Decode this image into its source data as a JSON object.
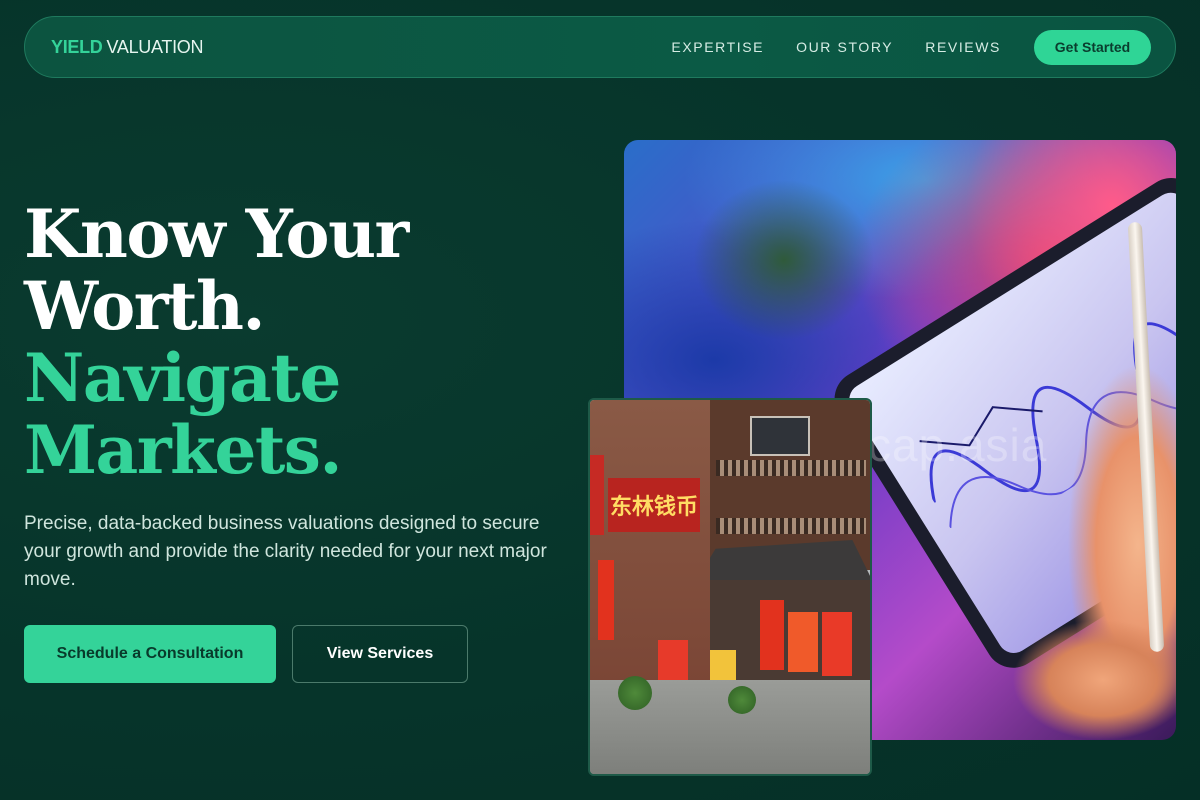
{
  "brand": {
    "part1": "YIELD",
    "part2": "VALUATION"
  },
  "nav": {
    "links": [
      "EXPERTISE",
      "OUR STORY",
      "REVIEWS"
    ],
    "cta": "Get Started"
  },
  "hero": {
    "headline_line1": "Know Your",
    "headline_line2": "Worth.",
    "headline_line3": "Navigate",
    "headline_line4": "Markets.",
    "subtext": "Precise, data-backed business valuations designed to secure your growth and provide the clarity needed for your next major move.",
    "primary_button": "Schedule a Consultation",
    "secondary_button": "View Services"
  },
  "images": {
    "main_watermark": "cap.asia",
    "street_sign": "东林钱币"
  },
  "colors": {
    "background": "#06352a",
    "accent": "#34d399",
    "nav_bg": "#0b5a45"
  }
}
